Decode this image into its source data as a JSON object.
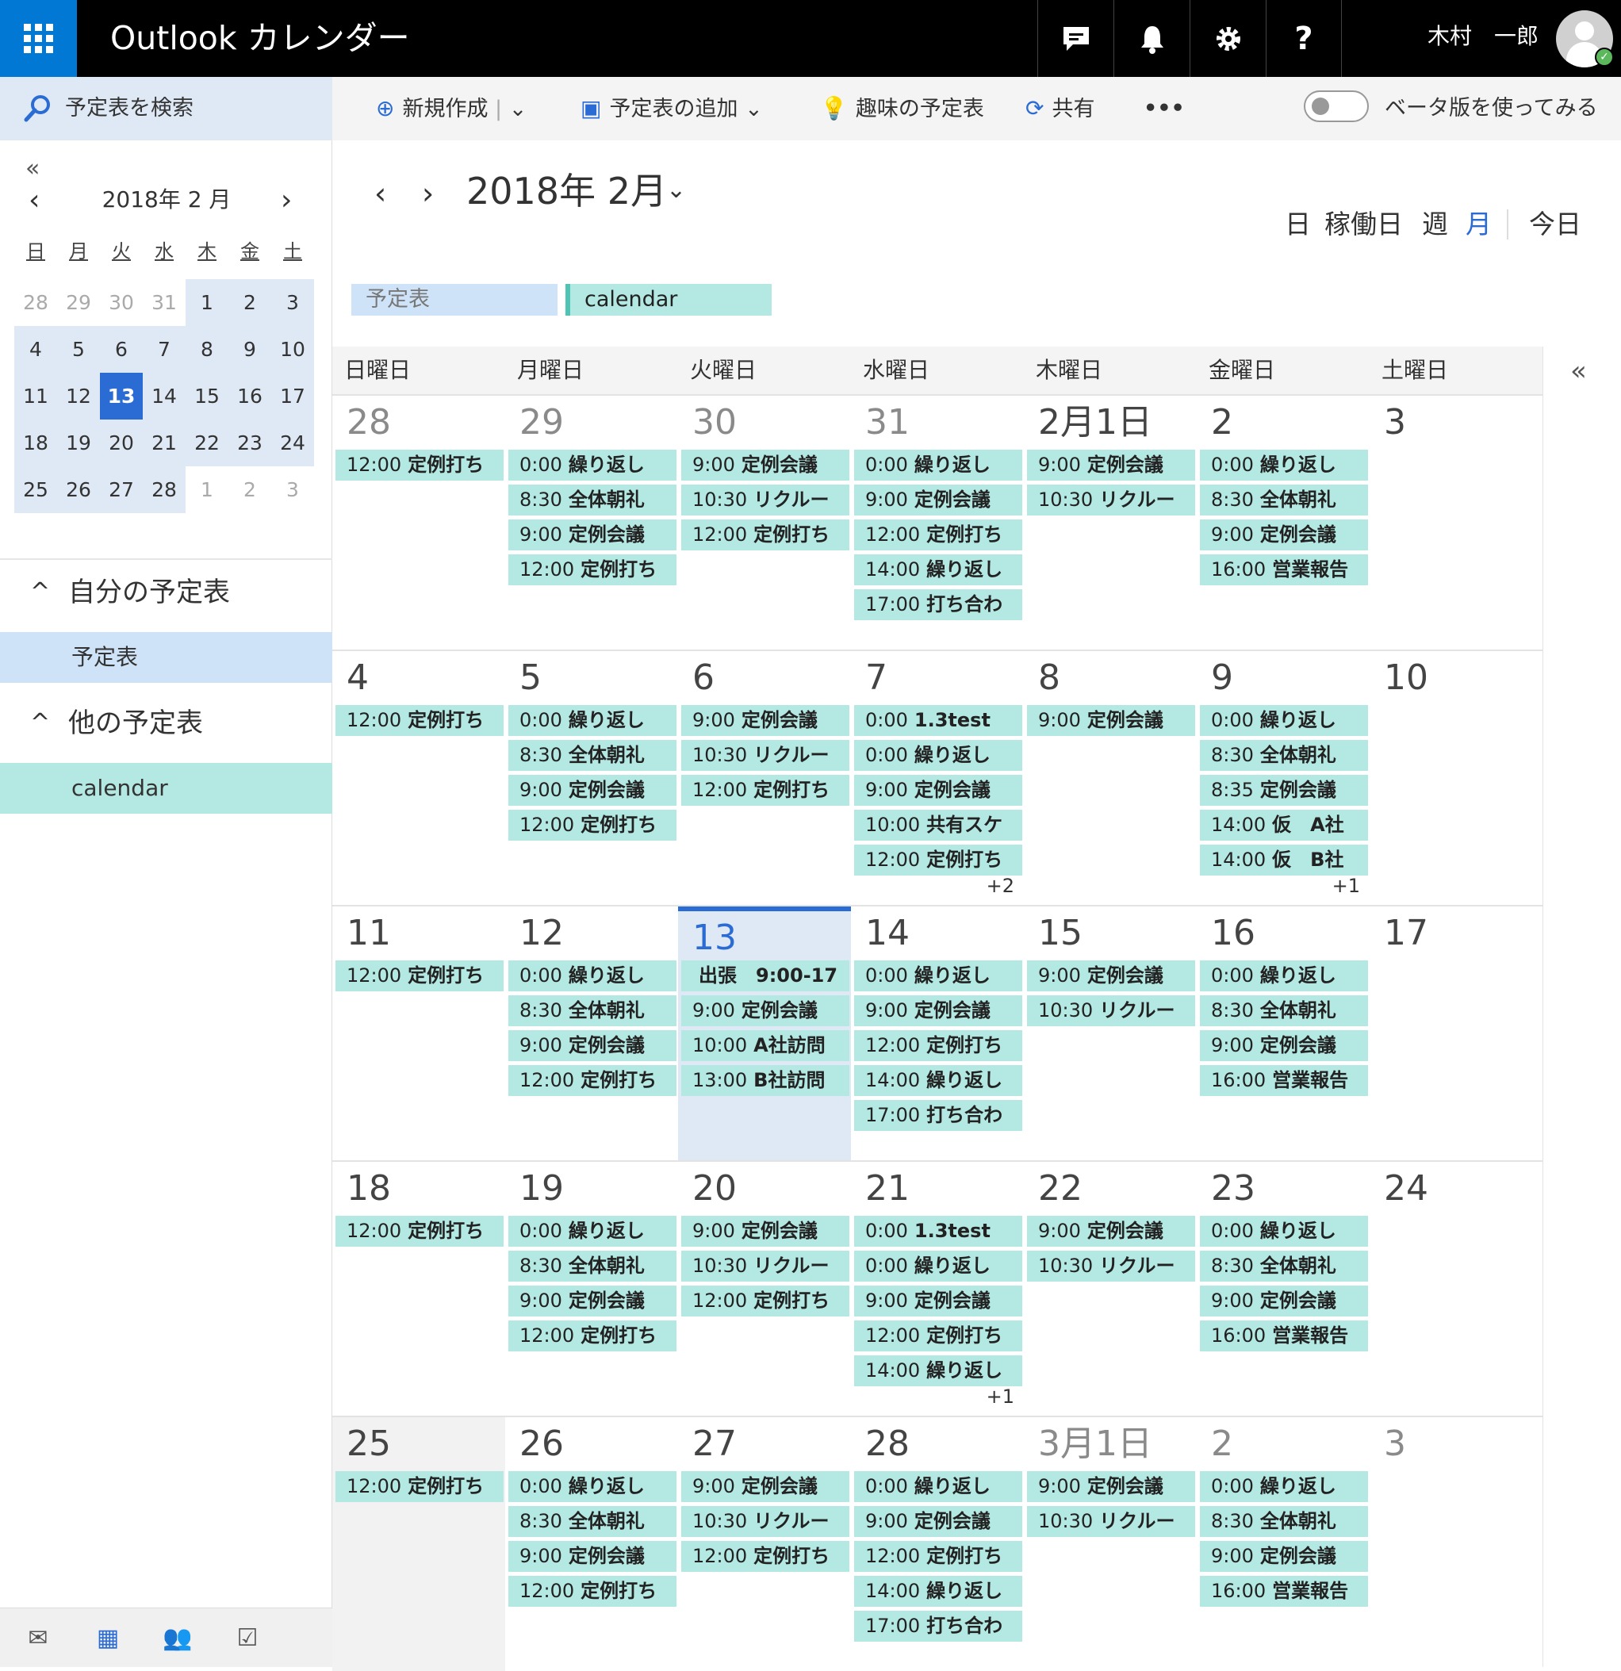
{
  "app": {
    "title": "Outlook カレンダー",
    "user": "木村　一郎"
  },
  "topbar_icons": [
    "chat-icon",
    "bell-icon",
    "gear-icon",
    "help-icon"
  ],
  "help_glyph": "?",
  "search": {
    "label": "予定表を検索"
  },
  "toolbar": {
    "new": "新規作成",
    "add_calendar": "予定表の追加",
    "interest": "趣味の予定表",
    "share": "共有",
    "more": "•••",
    "beta": "ベータ版を使ってみる"
  },
  "mini": {
    "title": "2018年 2 月",
    "dow": [
      "日",
      "月",
      "火",
      "水",
      "木",
      "金",
      "土"
    ],
    "rows": [
      [
        "28",
        "29",
        "30",
        "31",
        "1",
        "2",
        "3"
      ],
      [
        "4",
        "5",
        "6",
        "7",
        "8",
        "9",
        "10"
      ],
      [
        "11",
        "12",
        "13",
        "14",
        "15",
        "16",
        "17"
      ],
      [
        "18",
        "19",
        "20",
        "21",
        "22",
        "23",
        "24"
      ],
      [
        "25",
        "26",
        "27",
        "28",
        "1",
        "2",
        "3"
      ]
    ],
    "today": "13"
  },
  "left": {
    "my_section": "自分の予定表",
    "my_item": "予定表",
    "other_section": "他の予定表",
    "other_item": "calendar"
  },
  "main": {
    "title": "2018年 2月",
    "views": {
      "day": "日",
      "workweek": "稼働日",
      "week": "週",
      "month": "月",
      "today": "今日"
    },
    "legend": [
      "予定表",
      "calendar"
    ]
  },
  "colors": {
    "accent": "#2b6cd4",
    "event": "#b4e9e3",
    "selection": "#dfe9f5"
  },
  "calendar": {
    "dow": [
      "日曜日",
      "月曜日",
      "火曜日",
      "水曜日",
      "木曜日",
      "金曜日",
      "土曜日"
    ],
    "weeks": [
      [
        {
          "d": "28",
          "faded": true,
          "ev": [
            [
              "12:00",
              "定例打ち"
            ]
          ]
        },
        {
          "d": "29",
          "faded": true,
          "ev": [
            [
              "0:00",
              "繰り返し"
            ],
            [
              "8:30",
              "全体朝礼"
            ],
            [
              "9:00",
              "定例会議"
            ],
            [
              "12:00",
              "定例打ち"
            ]
          ]
        },
        {
          "d": "30",
          "faded": true,
          "ev": [
            [
              "9:00",
              "定例会議"
            ],
            [
              "10:30",
              "リクルー"
            ],
            [
              "12:00",
              "定例打ち"
            ]
          ]
        },
        {
          "d": "31",
          "faded": true,
          "ev": [
            [
              "0:00",
              "繰り返し"
            ],
            [
              "9:00",
              "定例会議"
            ],
            [
              "12:00",
              "定例打ち"
            ],
            [
              "14:00",
              "繰り返し"
            ],
            [
              "17:00",
              "打ち合わ"
            ]
          ]
        },
        {
          "d": "2月1日",
          "ev": [
            [
              "9:00",
              "定例会議"
            ],
            [
              "10:30",
              "リクルー"
            ]
          ]
        },
        {
          "d": "2",
          "ev": [
            [
              "0:00",
              "繰り返し"
            ],
            [
              "8:30",
              "全体朝礼"
            ],
            [
              "9:00",
              "定例会議"
            ],
            [
              "16:00",
              "営業報告"
            ]
          ]
        },
        {
          "d": "3",
          "ev": []
        }
      ],
      [
        {
          "d": "4",
          "ev": [
            [
              "12:00",
              "定例打ち"
            ]
          ]
        },
        {
          "d": "5",
          "ev": [
            [
              "0:00",
              "繰り返し"
            ],
            [
              "8:30",
              "全体朝礼"
            ],
            [
              "9:00",
              "定例会議"
            ],
            [
              "12:00",
              "定例打ち"
            ]
          ]
        },
        {
          "d": "6",
          "ev": [
            [
              "9:00",
              "定例会議"
            ],
            [
              "10:30",
              "リクルー"
            ],
            [
              "12:00",
              "定例打ち"
            ]
          ]
        },
        {
          "d": "7",
          "ev": [
            [
              "0:00",
              "1.3test"
            ],
            [
              "0:00",
              "繰り返し"
            ],
            [
              "9:00",
              "定例会議"
            ],
            [
              "10:00",
              "共有スケ"
            ],
            [
              "12:00",
              "定例打ち"
            ]
          ],
          "more": "+2"
        },
        {
          "d": "8",
          "ev": [
            [
              "9:00",
              "定例会議"
            ]
          ]
        },
        {
          "d": "9",
          "ev": [
            [
              "0:00",
              "繰り返し"
            ],
            [
              "8:30",
              "全体朝礼"
            ],
            [
              "8:35",
              "定例会議"
            ],
            [
              "14:00",
              "仮　A社"
            ],
            [
              "14:00",
              "仮　B社"
            ]
          ],
          "more": "+1"
        },
        {
          "d": "10",
          "ev": []
        }
      ],
      [
        {
          "d": "11",
          "ev": [
            [
              "12:00",
              "定例打ち"
            ]
          ]
        },
        {
          "d": "12",
          "ev": [
            [
              "0:00",
              "繰り返し"
            ],
            [
              "8:30",
              "全体朝礼"
            ],
            [
              "9:00",
              "定例会議"
            ],
            [
              "12:00",
              "定例打ち"
            ]
          ]
        },
        {
          "d": "13",
          "today": true,
          "ev": [
            [
              "",
              "出張　9:00-17"
            ],
            [
              "9:00",
              "定例会議"
            ],
            [
              "10:00",
              "A社訪問"
            ],
            [
              "13:00",
              "B社訪問"
            ]
          ]
        },
        {
          "d": "14",
          "ev": [
            [
              "0:00",
              "繰り返し"
            ],
            [
              "9:00",
              "定例会議"
            ],
            [
              "12:00",
              "定例打ち"
            ],
            [
              "14:00",
              "繰り返し"
            ],
            [
              "17:00",
              "打ち合わ"
            ]
          ]
        },
        {
          "d": "15",
          "ev": [
            [
              "9:00",
              "定例会議"
            ],
            [
              "10:30",
              "リクルー"
            ]
          ]
        },
        {
          "d": "16",
          "ev": [
            [
              "0:00",
              "繰り返し"
            ],
            [
              "8:30",
              "全体朝礼"
            ],
            [
              "9:00",
              "定例会議"
            ],
            [
              "16:00",
              "営業報告"
            ]
          ]
        },
        {
          "d": "17",
          "ev": []
        }
      ],
      [
        {
          "d": "18",
          "ev": [
            [
              "12:00",
              "定例打ち"
            ]
          ]
        },
        {
          "d": "19",
          "ev": [
            [
              "0:00",
              "繰り返し"
            ],
            [
              "8:30",
              "全体朝礼"
            ],
            [
              "9:00",
              "定例会議"
            ],
            [
              "12:00",
              "定例打ち"
            ]
          ]
        },
        {
          "d": "20",
          "ev": [
            [
              "9:00",
              "定例会議"
            ],
            [
              "10:30",
              "リクルー"
            ],
            [
              "12:00",
              "定例打ち"
            ]
          ]
        },
        {
          "d": "21",
          "ev": [
            [
              "0:00",
              "1.3test"
            ],
            [
              "0:00",
              "繰り返し"
            ],
            [
              "9:00",
              "定例会議"
            ],
            [
              "12:00",
              "定例打ち"
            ],
            [
              "14:00",
              "繰り返し"
            ]
          ],
          "more": "+1"
        },
        {
          "d": "22",
          "ev": [
            [
              "9:00",
              "定例会議"
            ],
            [
              "10:30",
              "リクルー"
            ]
          ]
        },
        {
          "d": "23",
          "ev": [
            [
              "0:00",
              "繰り返し"
            ],
            [
              "8:30",
              "全体朝礼"
            ],
            [
              "9:00",
              "定例会議"
            ],
            [
              "16:00",
              "営業報告"
            ]
          ]
        },
        {
          "d": "24",
          "ev": []
        }
      ],
      [
        {
          "d": "25",
          "grey": true,
          "ev": [
            [
              "12:00",
              "定例打ち"
            ]
          ]
        },
        {
          "d": "26",
          "ev": [
            [
              "0:00",
              "繰り返し"
            ],
            [
              "8:30",
              "全体朝礼"
            ],
            [
              "9:00",
              "定例会議"
            ],
            [
              "12:00",
              "定例打ち"
            ]
          ]
        },
        {
          "d": "27",
          "ev": [
            [
              "9:00",
              "定例会議"
            ],
            [
              "10:30",
              "リクルー"
            ],
            [
              "12:00",
              "定例打ち"
            ]
          ]
        },
        {
          "d": "28",
          "ev": [
            [
              "0:00",
              "繰り返し"
            ],
            [
              "9:00",
              "定例会議"
            ],
            [
              "12:00",
              "定例打ち"
            ],
            [
              "14:00",
              "繰り返し"
            ],
            [
              "17:00",
              "打ち合わ"
            ]
          ]
        },
        {
          "d": "3月1日",
          "faded": true,
          "ev": [
            [
              "9:00",
              "定例会議"
            ],
            [
              "10:30",
              "リクルー"
            ]
          ]
        },
        {
          "d": "2",
          "faded": true,
          "ev": [
            [
              "0:00",
              "繰り返し"
            ],
            [
              "8:30",
              "全体朝礼"
            ],
            [
              "9:00",
              "定例会議"
            ],
            [
              "16:00",
              "営業報告"
            ]
          ]
        },
        {
          "d": "3",
          "faded": true,
          "ev": []
        }
      ]
    ]
  }
}
